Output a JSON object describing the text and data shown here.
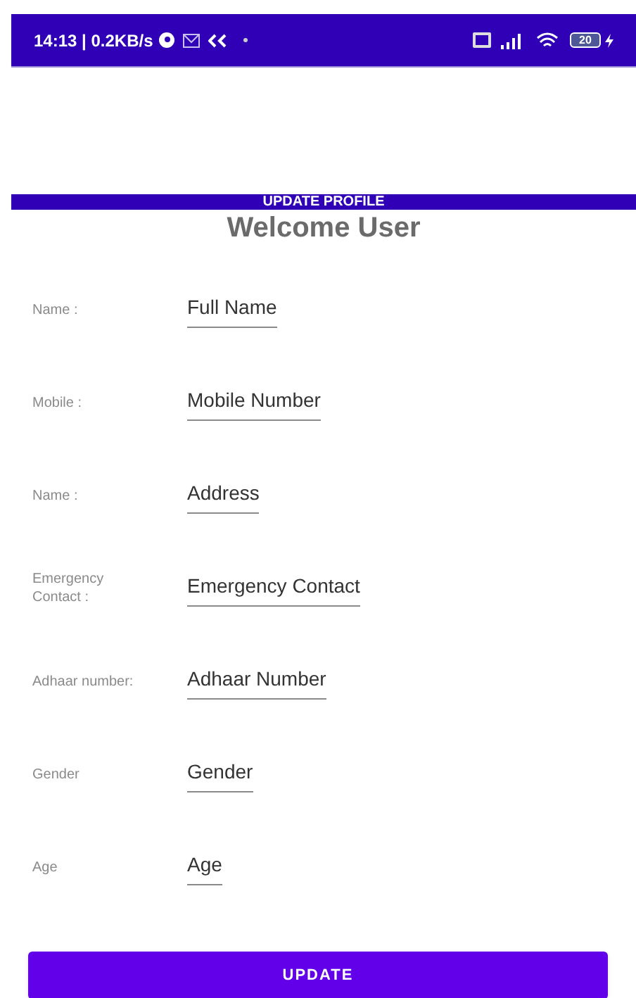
{
  "status_bar": {
    "time": "14:13 | 0.2KB/s",
    "battery": "20"
  },
  "banner": {
    "title": "UPDATE PROFILE"
  },
  "heading": "Welcome User",
  "fields": [
    {
      "label": "Name :",
      "placeholder": "Full Name"
    },
    {
      "label": "Mobile :",
      "placeholder": "Mobile Number"
    },
    {
      "label": "Name :",
      "placeholder": "Address"
    },
    {
      "label": "Emergency Contact :",
      "placeholder": "Emergency Contact"
    },
    {
      "label": "Adhaar number:",
      "placeholder": "Adhaar Number"
    },
    {
      "label": "Gender",
      "placeholder": "Gender"
    },
    {
      "label": "Age",
      "placeholder": "Age"
    }
  ],
  "button": "UPDATE"
}
